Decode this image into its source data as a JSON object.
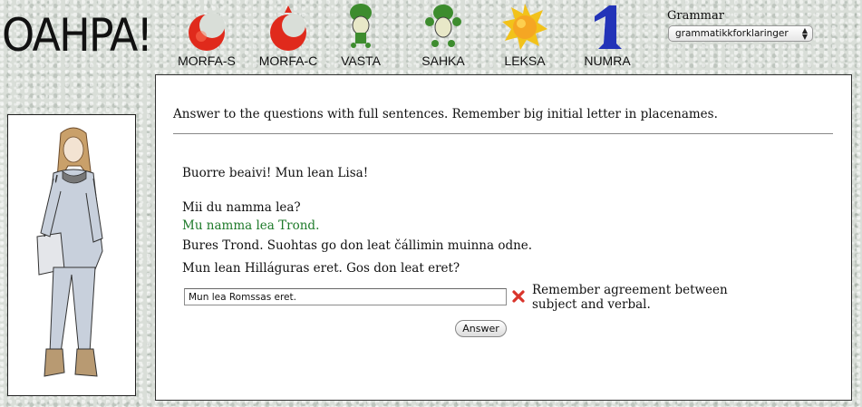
{
  "logo": {
    "text": "OAHPA!"
  },
  "nav": [
    {
      "label": "MORFA-S",
      "icon": "red-moon-icon"
    },
    {
      "label": "MORFA-C",
      "icon": "red-moon-leaf-icon"
    },
    {
      "label": "VASTA",
      "icon": "green-frog-hat-icon"
    },
    {
      "label": "SAHKA",
      "icon": "green-frog-icon"
    },
    {
      "label": "LEKSA",
      "icon": "sun-icon"
    },
    {
      "label": "NUMRA",
      "icon": "blue-number-one-icon"
    }
  ],
  "grammar": {
    "label": "Grammar",
    "selected": "grammatikkforklaringer"
  },
  "colors": {
    "correct_text": "#1e7a2a",
    "error_icon": "#d9342b",
    "panel_border": "#333333"
  },
  "main": {
    "instructions": "Answer to the questions with full sentences. Remember big initial letter in placenames.",
    "dialogue": [
      "Buorre beaivi! Mun lean Lisa!",
      "Mii du namma lea?",
      "Mu namma lea Trond.",
      "Bures Trond. Suohtas go don leat čállimin muinna odne.",
      "Mun lean Hilláguras eret. Gos don leat eret?"
    ],
    "answer_input_value": "Mun lea Romssas eret.",
    "feedback": "Remember agreement between subject and verbal.",
    "answer_button": "Answer"
  }
}
